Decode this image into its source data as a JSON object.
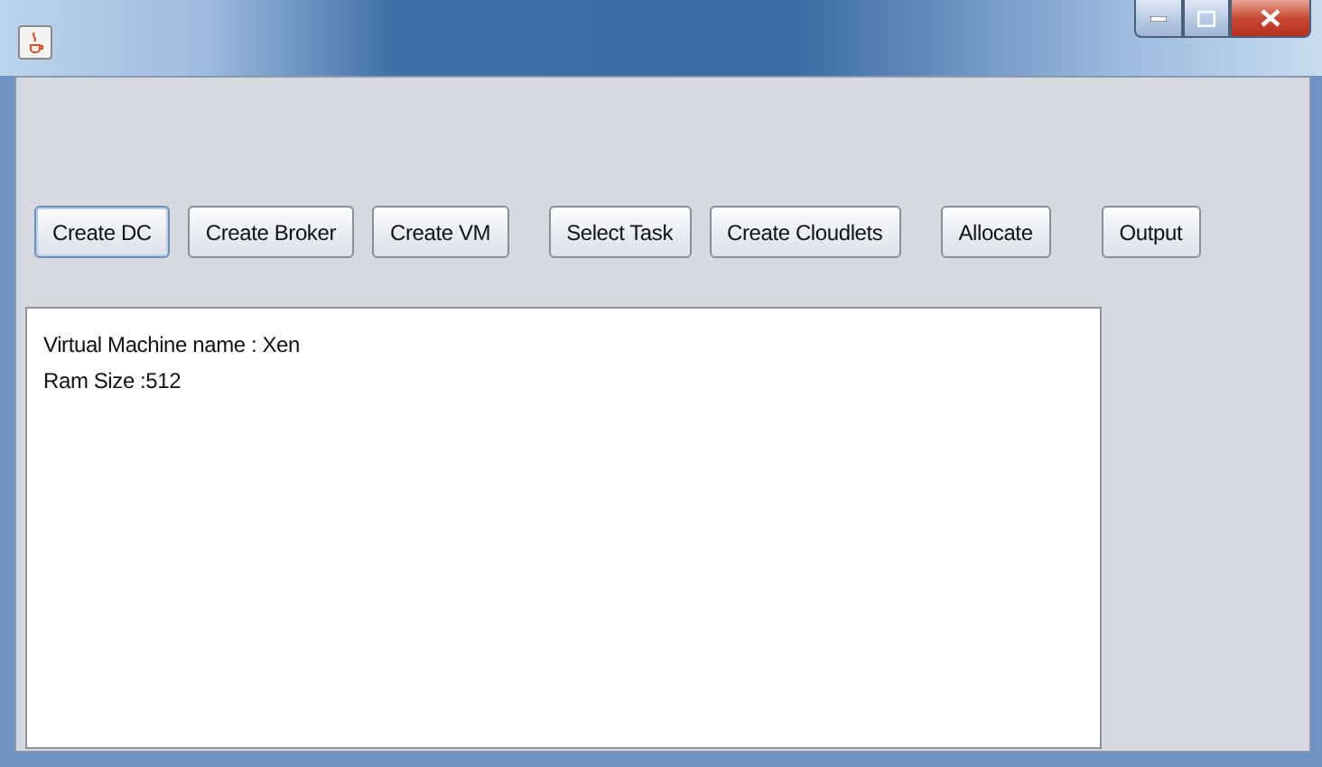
{
  "buttons": [
    {
      "label": "Create DC",
      "focused": true
    },
    {
      "label": "Create Broker",
      "focused": false
    },
    {
      "label": "Create VM",
      "focused": false
    },
    {
      "label": "Select Task",
      "focused": false
    },
    {
      "label": "Create Cloudlets",
      "focused": false
    },
    {
      "label": "Allocate",
      "focused": false
    },
    {
      "label": "Output",
      "focused": false
    }
  ],
  "output": {
    "lines": [
      "Virtual Machine name : Xen",
      "Ram Size :512"
    ]
  }
}
